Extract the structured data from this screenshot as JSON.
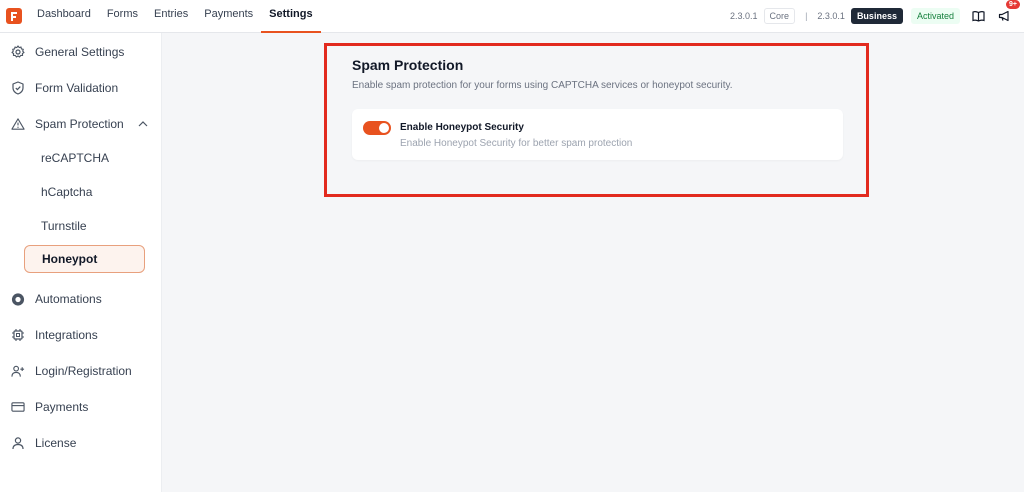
{
  "nav": {
    "items": [
      "Dashboard",
      "Forms",
      "Entries",
      "Payments",
      "Settings"
    ],
    "active": "Settings"
  },
  "header": {
    "core_version": "2.3.0.1",
    "core_label": "Core",
    "separator": "|",
    "business_version": "2.3.0.1",
    "business_label": "Business",
    "status": "Activated",
    "notification_count": "9+"
  },
  "sidebar": {
    "items": [
      {
        "label": "General Settings",
        "icon": "gear-icon"
      },
      {
        "label": "Form Validation",
        "icon": "shield-icon"
      },
      {
        "label": "Spam Protection",
        "icon": "warning-icon"
      },
      {
        "label": "Automations",
        "icon": "automation-icon"
      },
      {
        "label": "Integrations",
        "icon": "chip-icon"
      },
      {
        "label": "Login/Registration",
        "icon": "user-plus-icon"
      },
      {
        "label": "Payments",
        "icon": "credit-card-icon"
      },
      {
        "label": "License",
        "icon": "user-icon"
      }
    ],
    "sub_items": [
      "reCAPTCHA",
      "hCaptcha",
      "Turnstile",
      "Honeypot"
    ],
    "active_sub": "Honeypot"
  },
  "main": {
    "title": "Spam Protection",
    "description": "Enable spam protection for your forms using CAPTCHA services or honeypot security.",
    "setting": {
      "label": "Enable Honeypot Security",
      "help": "Enable Honeypot Security for better spam protection",
      "enabled": true
    }
  },
  "colors": {
    "accent": "#e8521f",
    "highlight": "#e22b1f"
  }
}
